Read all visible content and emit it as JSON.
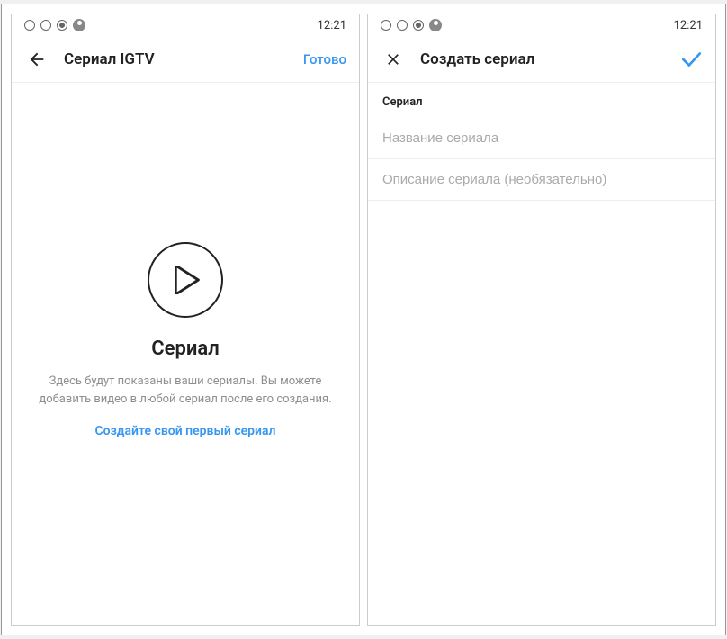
{
  "status": {
    "time": "12:21"
  },
  "screen1": {
    "header": {
      "title": "Сериал IGTV",
      "action": "Готово"
    },
    "empty": {
      "title": "Сериал",
      "description": "Здесь будут показаны ваши сериалы. Вы можете добавить видео в любой сериал после его создания.",
      "link": "Создайте свой первый сериал"
    }
  },
  "screen2": {
    "header": {
      "title": "Создать сериал"
    },
    "form": {
      "section_label": "Сериал",
      "name_placeholder": "Название сериала",
      "name_value": "",
      "desc_placeholder": "Описание сериала (необязательно)",
      "desc_value": ""
    }
  }
}
